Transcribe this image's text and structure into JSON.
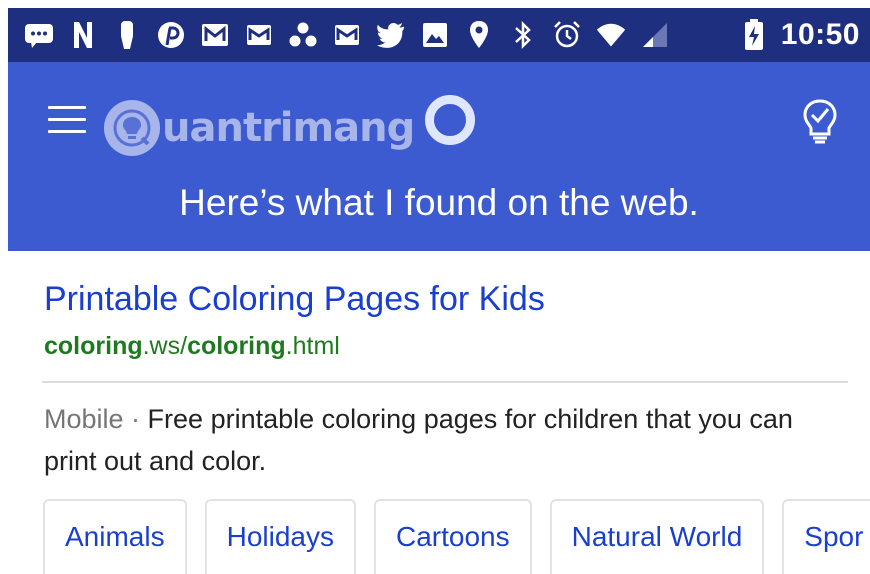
{
  "status_bar": {
    "icons": [
      "message-bubble-icon",
      "netflix-n-icon",
      "bluetooth-key-icon",
      "pinterest-icon",
      "gmail-icon",
      "gmail-icon",
      "team-dots-icon",
      "gmail-icon",
      "twitter-icon",
      "gallery-icon",
      "location-icon",
      "bluetooth-icon",
      "alarm-icon",
      "wifi-icon",
      "cell-signal-icon",
      "battery-charging-icon"
    ],
    "time": "10:50",
    "background_color": "#1f2f7f"
  },
  "header": {
    "logo_text": "uantrimang",
    "message": "Here’s what I found on the web.",
    "background_color": "#3d5bd1"
  },
  "result": {
    "title": "Printable Coloring Pages for Kids",
    "url": {
      "part1": "coloring",
      "part2": ".ws/",
      "part3": "coloring",
      "part4": ".html"
    },
    "snippet_prefix": "Mobile",
    "snippet_sep": " · ",
    "snippet": "Free printable coloring pages for children that you can print out and color.",
    "title_color": "#1a3fcf",
    "url_color": "#1f7a1f"
  },
  "categories": [
    "Animals",
    "Holidays",
    "Cartoons",
    "Natural World",
    "Spor"
  ]
}
